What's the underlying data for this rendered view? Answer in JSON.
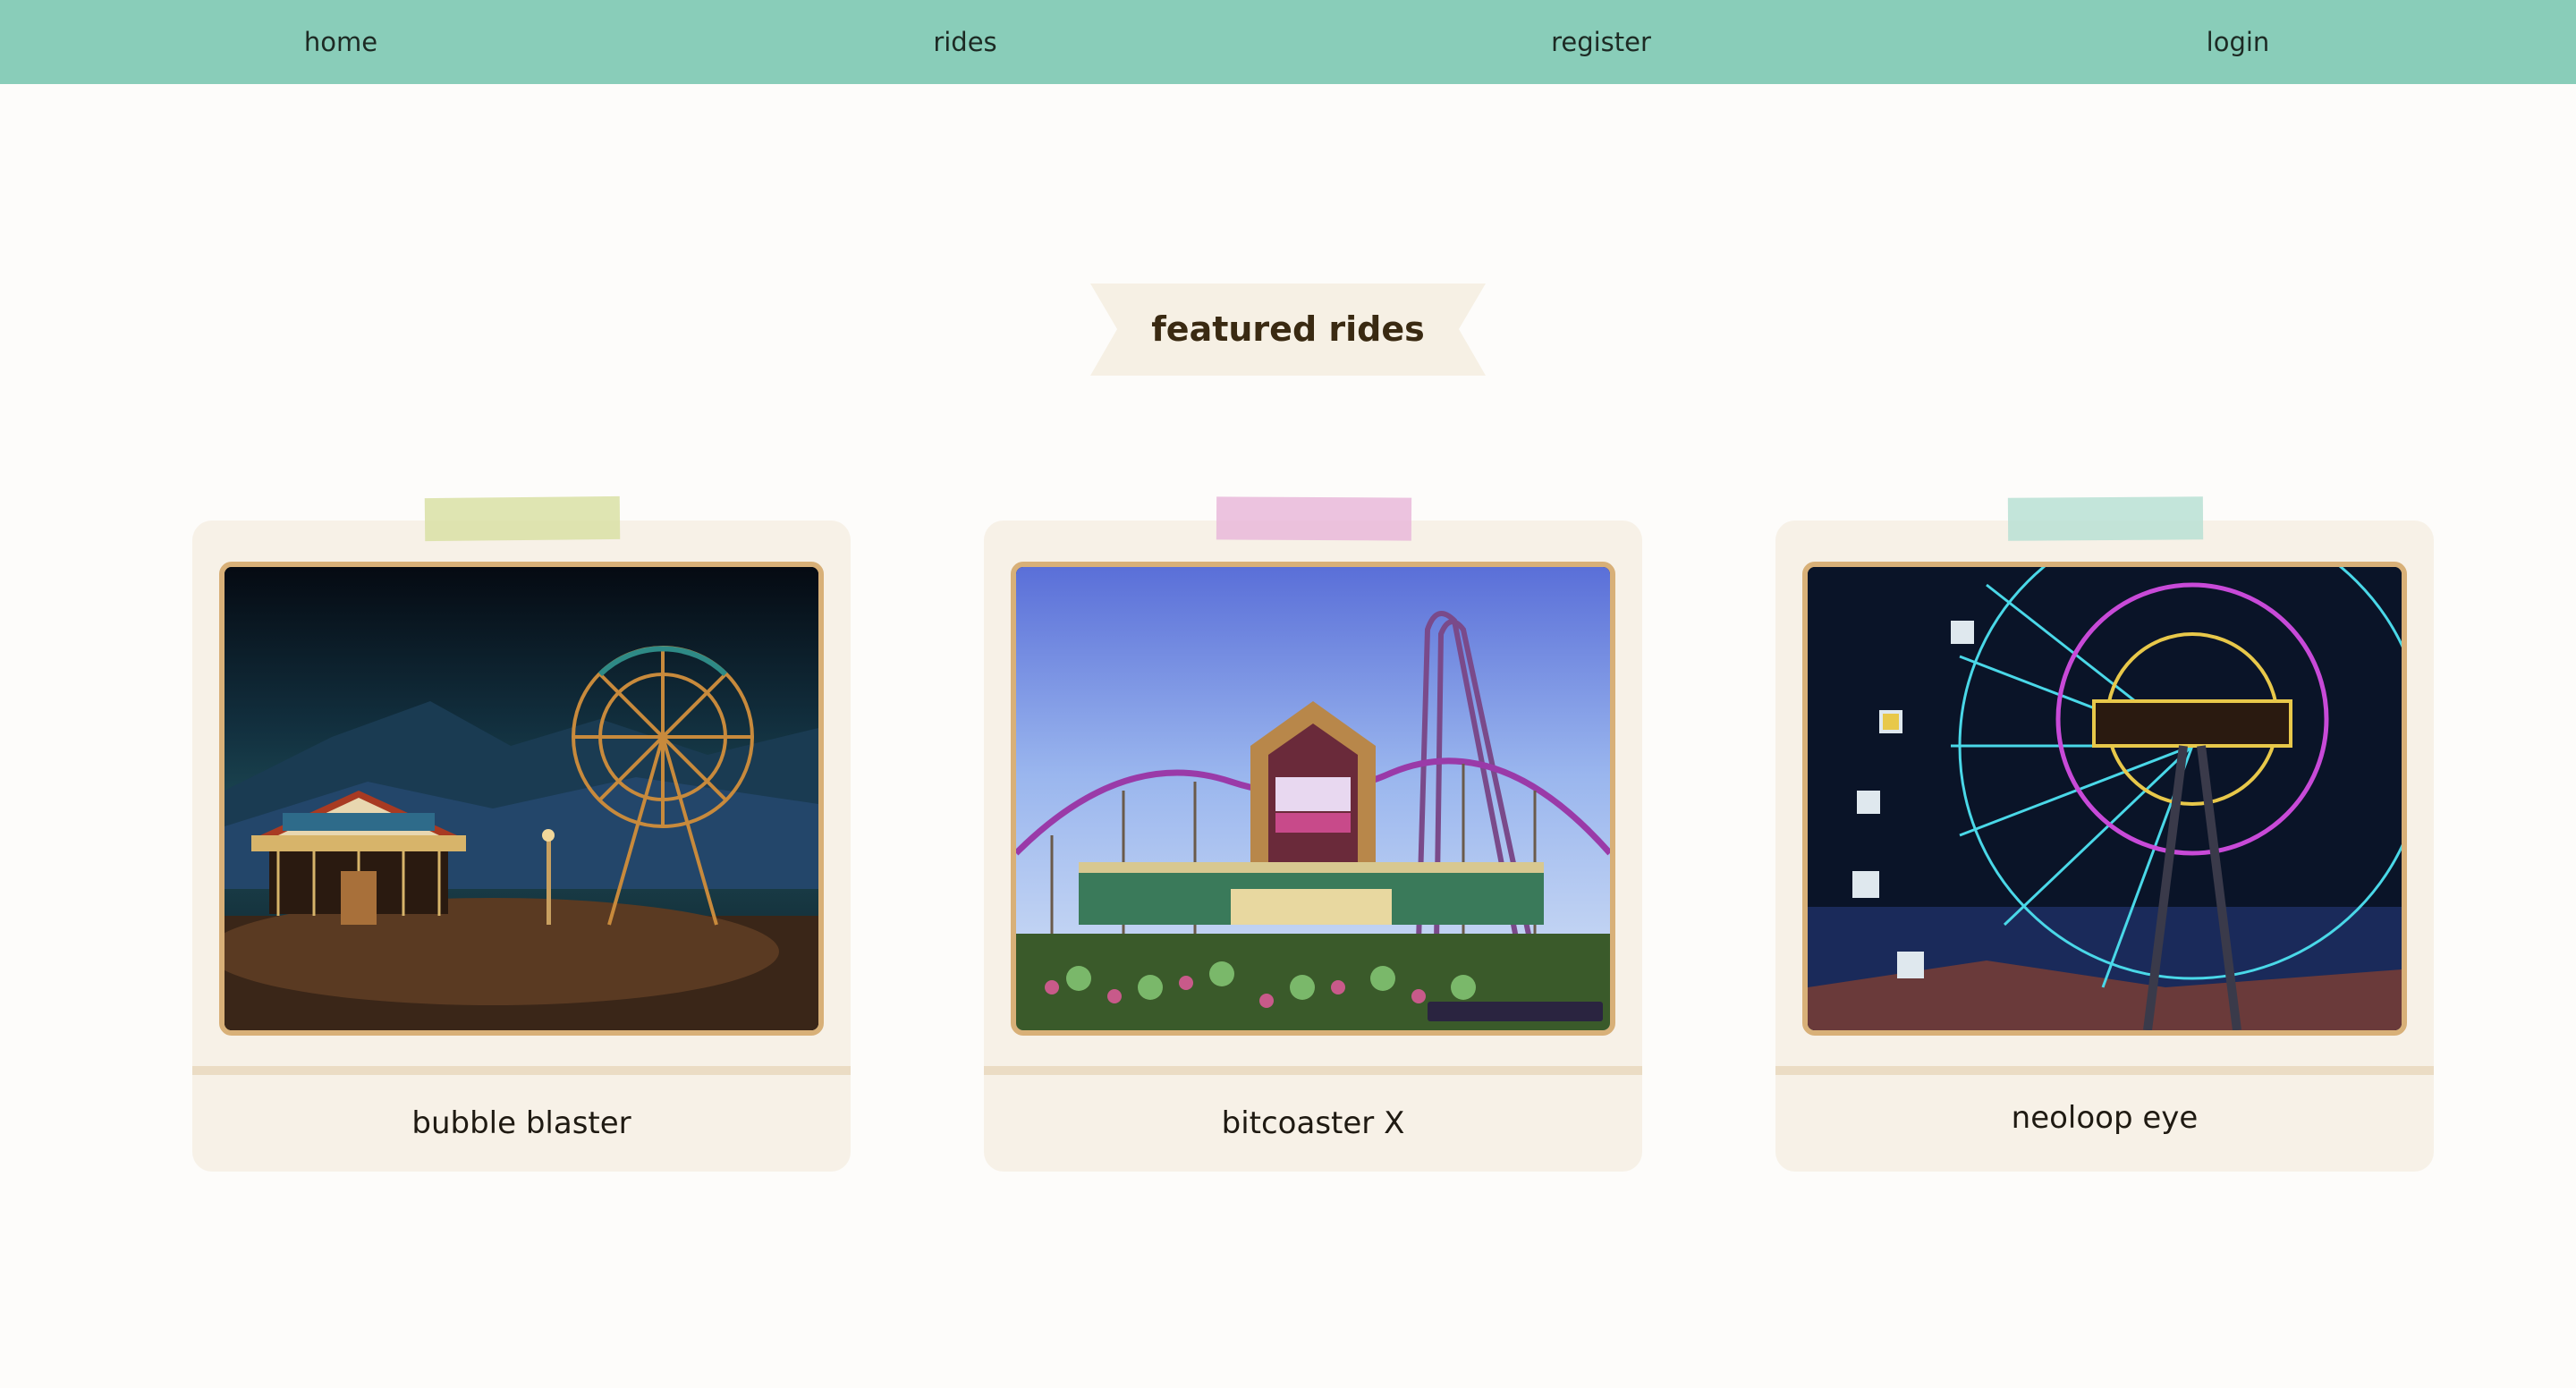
{
  "nav": {
    "items": [
      {
        "label": "home"
      },
      {
        "label": "rides"
      },
      {
        "label": "register"
      },
      {
        "label": "login"
      }
    ]
  },
  "section": {
    "title": "featured rides"
  },
  "rides": [
    {
      "name": "bubble blaster",
      "tape_color": "#d9e0a4",
      "image": "night-carnival-ferris-wheel-carousel"
    },
    {
      "name": "bitcoaster X",
      "tape_color": "#e9b9d9",
      "image": "wooden-rollercoaster-station"
    },
    {
      "name": "neoloop eye",
      "tape_color": "#b8e0d3",
      "image": "neon-ferris-wheel-night"
    }
  ],
  "colors": {
    "navbar": "#89cdb9",
    "card_bg": "#f7f1e7",
    "frame_border": "#d8b078",
    "banner_bg": "#f6f0e4",
    "page_bg": "#fdfcfa"
  }
}
